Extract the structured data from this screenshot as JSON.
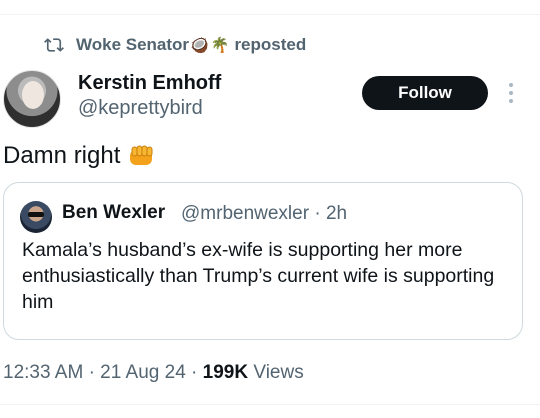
{
  "repost": {
    "reposter_name": "Woke Senator",
    "emoji_1": "🥥",
    "emoji_2": "🌴",
    "label": "reposted",
    "icon": "repost-icon"
  },
  "post": {
    "author_name": "Kerstin Emhoff",
    "author_handle": "@keprettybird",
    "follow_label": "Follow",
    "text": "Damn right",
    "text_icon": "fist-bump-icon"
  },
  "quote": {
    "author_name": "Ben Wexler",
    "author_handle": "@mrbenwexler",
    "separator": "·",
    "time": "2h",
    "text": "Kamala’s husband’s ex-wife is supporting her more enthusiastically than Trump’s current wife is supporting him"
  },
  "footer": {
    "time": "12:33 AM",
    "date": "21 Aug 24",
    "separator": "·",
    "views_count": "199K",
    "views_label": "Views"
  },
  "colors": {
    "text_primary": "#0f1419",
    "text_secondary": "#536471",
    "border": "#cfd9de",
    "follow_bg": "#0f1419"
  }
}
